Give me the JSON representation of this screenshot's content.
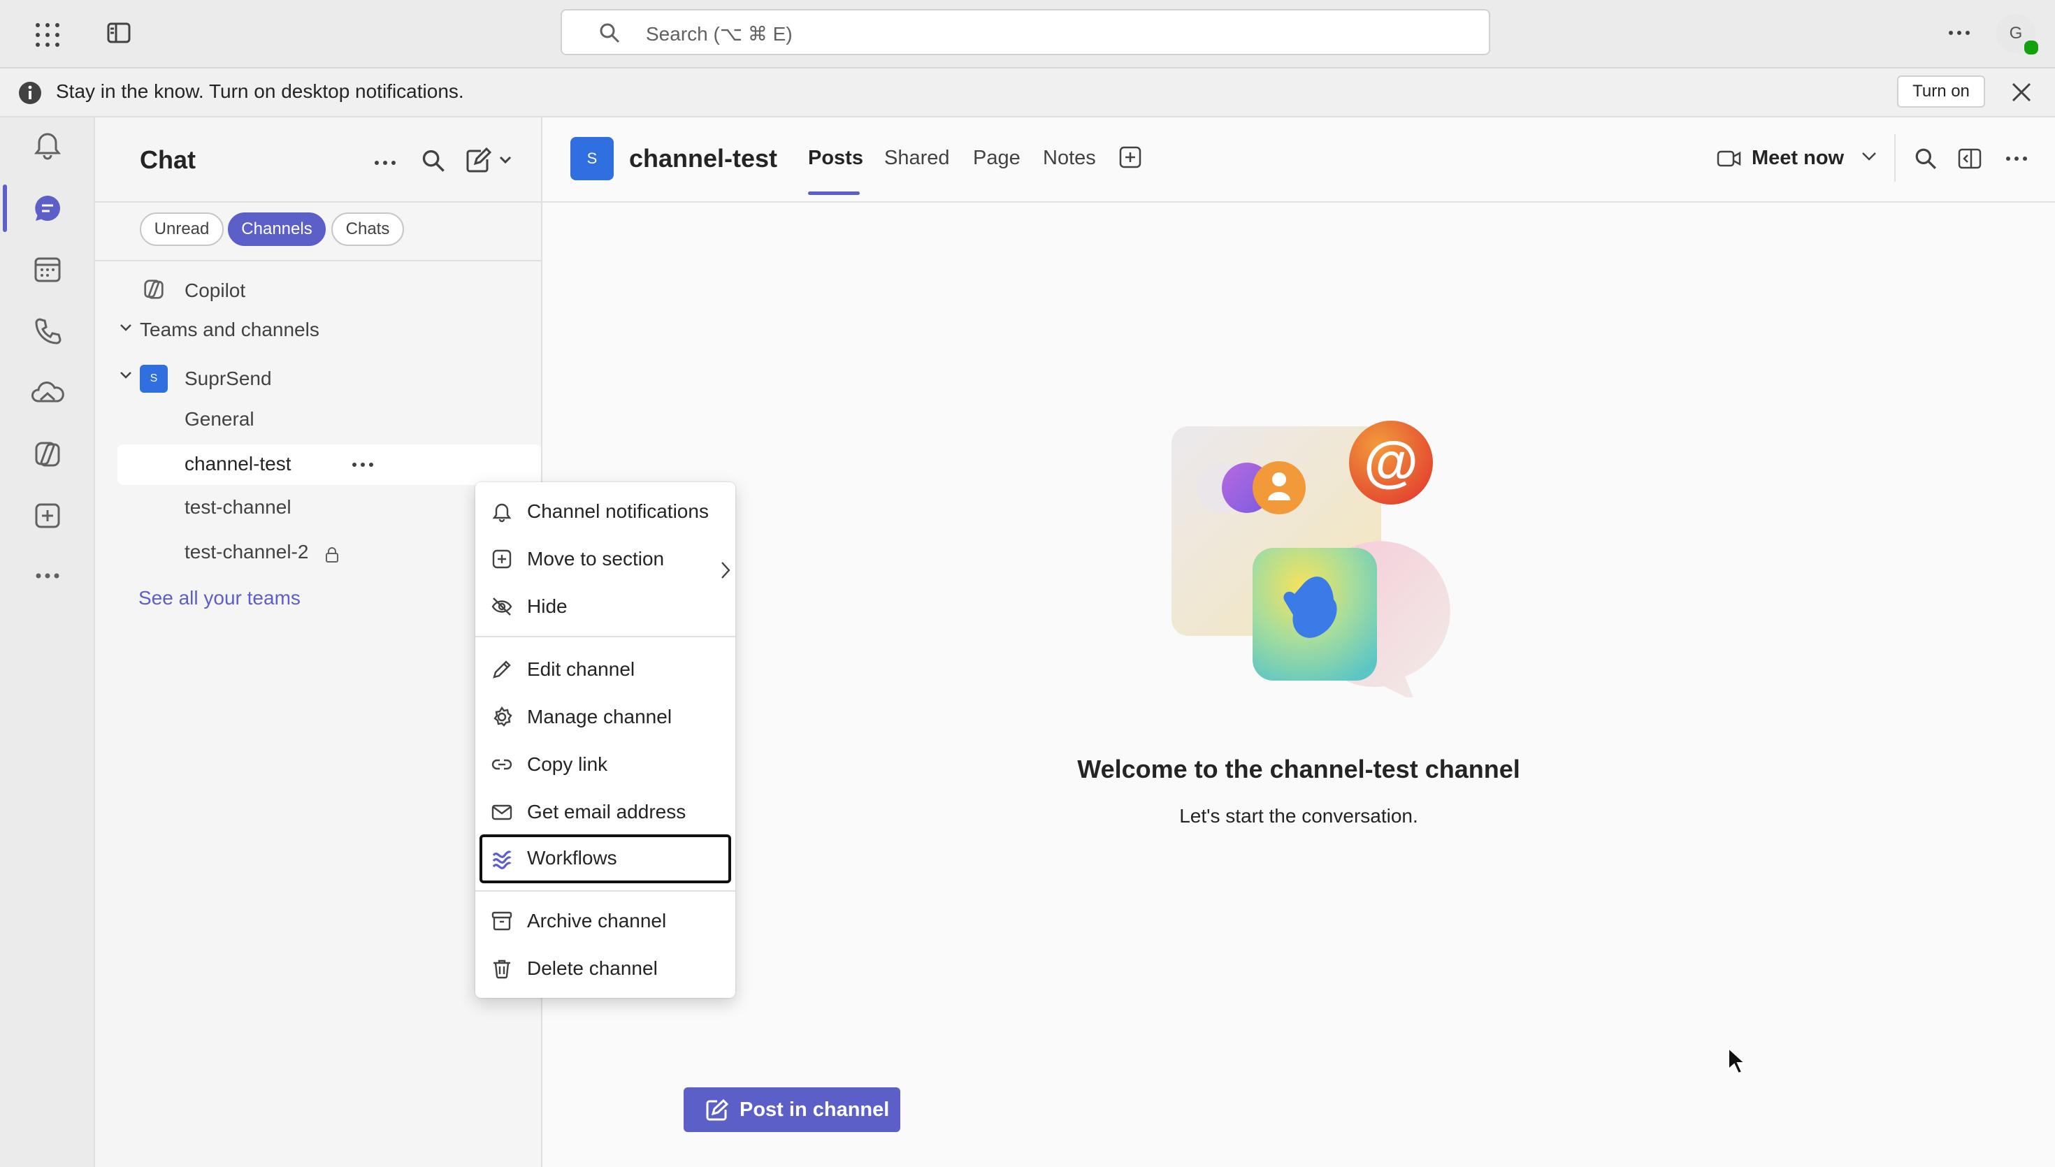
{
  "topbar": {
    "search_placeholder": "Search (⌥ ⌘ E)",
    "avatar_initial": "G"
  },
  "banner": {
    "text": "Stay in the know. Turn on desktop notifications.",
    "button": "Turn on"
  },
  "sidebar": {
    "title": "Chat",
    "filters": [
      "Unread",
      "Channels",
      "Chats"
    ],
    "active_filter": "Channels",
    "copilot": "Copilot",
    "section": "Teams and channels",
    "team": {
      "name": "SuprSend",
      "avatar": "S"
    },
    "channels": [
      "General",
      "channel-test",
      "test-channel",
      "test-channel-2"
    ],
    "selected_channel": "channel-test",
    "see_all": "See all your teams"
  },
  "context_menu": {
    "items": [
      {
        "label": "Channel notifications",
        "icon": "bell-icon"
      },
      {
        "label": "Move to section",
        "icon": "add-square-icon"
      },
      {
        "label": "Hide",
        "icon": "eye-off-icon"
      },
      {
        "label": "Edit channel",
        "icon": "pencil-icon"
      },
      {
        "label": "Manage channel",
        "icon": "gear-icon"
      },
      {
        "label": "Copy link",
        "icon": "link-icon"
      },
      {
        "label": "Get email address",
        "icon": "mail-icon"
      },
      {
        "label": "Workflows",
        "icon": "workflows-icon"
      },
      {
        "label": "Archive channel",
        "icon": "archive-icon"
      },
      {
        "label": "Delete channel",
        "icon": "trash-icon"
      }
    ],
    "focused": "Workflows"
  },
  "channel_header": {
    "avatar": "S",
    "name": "channel-test",
    "tabs": [
      "Posts",
      "Shared",
      "Page",
      "Notes"
    ],
    "active_tab": "Posts",
    "meet_now": "Meet now"
  },
  "main": {
    "welcome_title": "Welcome to the channel-test channel",
    "welcome_sub": "Let's start the conversation.",
    "post_button": "Post in channel"
  },
  "colors": {
    "accent": "#5b5fc7",
    "team_avatar": "#2f6fe0",
    "presence": "#13a10e"
  }
}
